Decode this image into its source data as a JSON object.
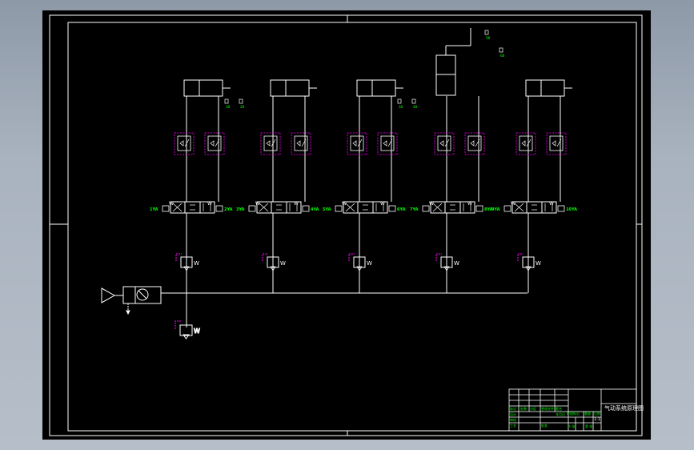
{
  "colors": {
    "background": "#000000",
    "line": "#ffffff",
    "label": "#00ff00",
    "dashed": "#ff00ff",
    "outer_bg": "#a9b3bf"
  },
  "circuits": [
    {
      "valve_left_label": "1YA",
      "valve_right_label": "2YA",
      "sensor_labels": [
        "1B",
        "2B"
      ]
    },
    {
      "valve_left_label": "3YA",
      "valve_right_label": "4YA",
      "sensor_labels": []
    },
    {
      "valve_left_label": "5YA",
      "valve_right_label": "6YA",
      "sensor_labels": [
        "3B",
        "4B"
      ]
    },
    {
      "valve_left_label": "7YA",
      "valve_right_label": "8YA",
      "sensor_labels": [
        "5B",
        "6B"
      ]
    },
    {
      "valve_left_label": "9YA",
      "valve_right_label": "10YA",
      "sensor_labels": []
    }
  ],
  "valve_spring_mark": "W",
  "title_block": {
    "drawing_title": "气动系统原理图",
    "scale": "1:1",
    "rows": [
      "标记",
      "处数",
      "分区",
      "更改文件号",
      "签名",
      "年月日",
      "设计",
      "审核",
      "工艺",
      "批准"
    ],
    "stage_labels": [
      "阶段标记",
      "重量",
      "比例"
    ],
    "sheet": [
      "共 张",
      "第 张"
    ]
  }
}
